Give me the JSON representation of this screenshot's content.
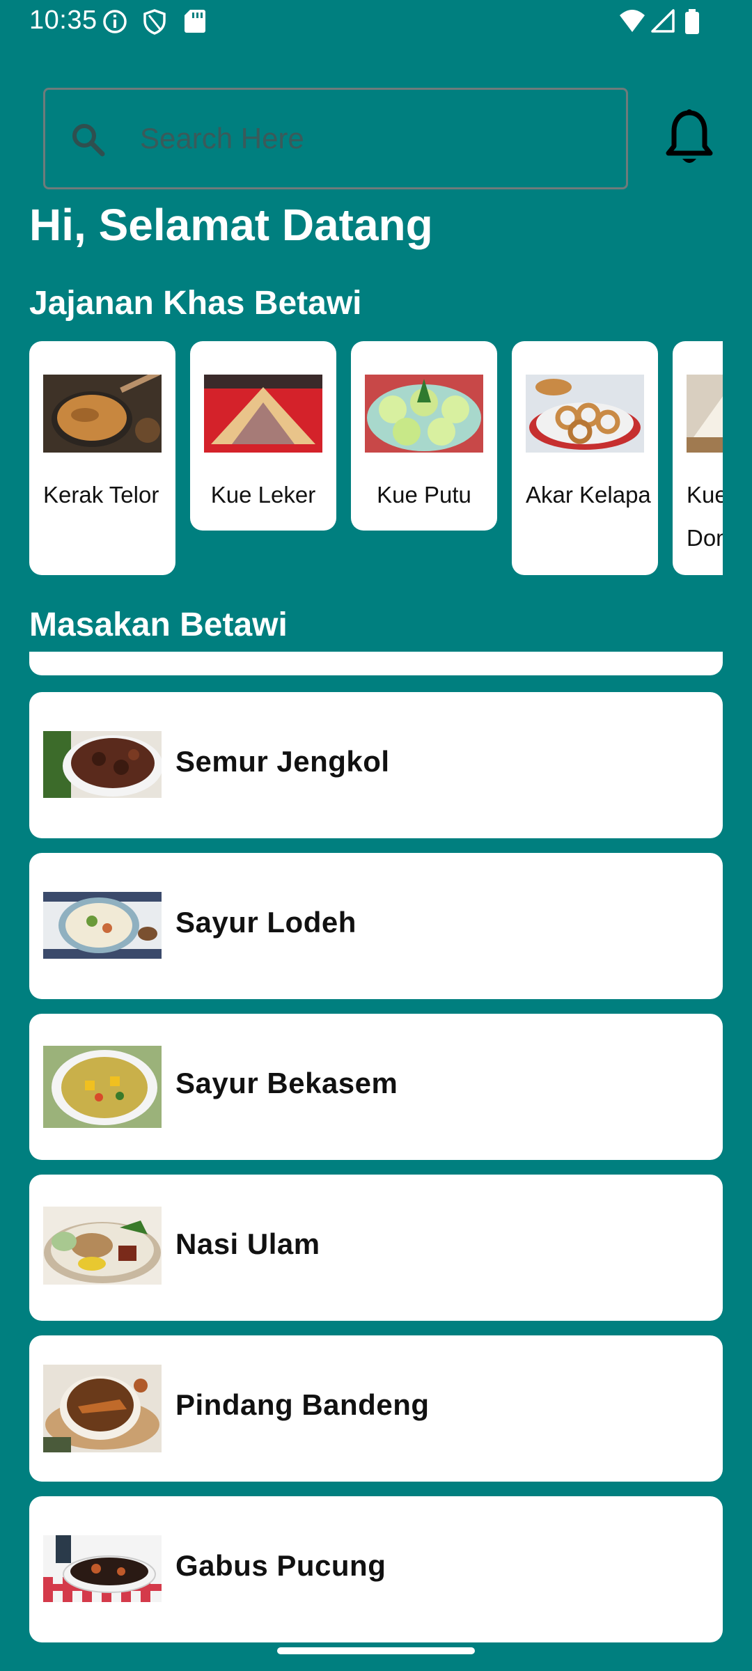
{
  "status": {
    "time": "10:35"
  },
  "search": {
    "placeholder": "Search Here"
  },
  "greeting": "Hi, Selamat Datang",
  "snacks_title": "Jajanan Khas Betawi",
  "snacks": [
    {
      "label": "Kerak Telor",
      "icon": "kerak-telor-photo"
    },
    {
      "label": "Kue Leker",
      "icon": "kue-leker-photo"
    },
    {
      "label": "Kue Putu",
      "icon": "kue-putu-photo"
    },
    {
      "label": "Akar Kelapa",
      "icon": "akar-kelapa-photo"
    },
    {
      "label": "Kue Dongkal",
      "icon": "kue-dongkal-photo"
    }
  ],
  "dishes_title": "Masakan Betawi",
  "dishes": [
    {
      "label": "Semur Jengkol"
    },
    {
      "label": "Sayur Lodeh"
    },
    {
      "label": "Sayur Bekasem"
    },
    {
      "label": "Nasi Ulam"
    },
    {
      "label": "Pindang Bandeng"
    },
    {
      "label": "Gabus Pucung"
    }
  ],
  "colors": {
    "background": "#007f7f",
    "card": "#ffffff",
    "text": "#111111"
  }
}
